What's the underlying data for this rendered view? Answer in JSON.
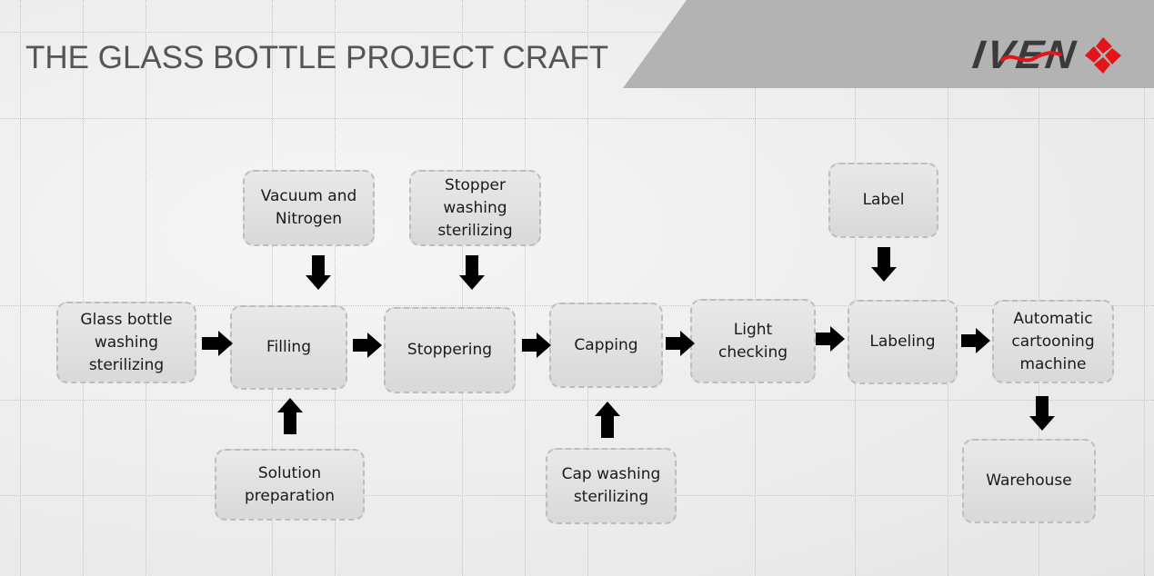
{
  "header": {
    "title": "THE GLASS BOTTLE PROJECT CRAFT",
    "logo_text": "IVEN",
    "logo_icon": "red-diamond-petals-icon",
    "accent_color": "#e3151b",
    "banner_color": "#b3b3b3"
  },
  "diagram": {
    "main_flow": [
      {
        "id": "glass-bottle-washing",
        "label": "Glass bottle\nwashing\nsterilizing"
      },
      {
        "id": "filling",
        "label": "Filling"
      },
      {
        "id": "stoppering",
        "label": "Stoppering"
      },
      {
        "id": "capping",
        "label": "Capping"
      },
      {
        "id": "light-checking",
        "label": "Light\nchecking"
      },
      {
        "id": "labeling",
        "label": "Labeling"
      },
      {
        "id": "automatic-cartooning",
        "label": "Automatic\ncartooning\nmachine"
      }
    ],
    "inputs": [
      {
        "id": "vacuum-nitrogen",
        "label": "Vacuum and\nNitrogen",
        "feeds": "filling",
        "position": "above"
      },
      {
        "id": "solution-preparation",
        "label": "Solution\npreparation",
        "feeds": "filling",
        "position": "below"
      },
      {
        "id": "stopper-washing",
        "label": "Stopper\nwashing\nsterilizing",
        "feeds": "stoppering",
        "position": "above"
      },
      {
        "id": "cap-washing",
        "label": "Cap washing\nsterilizing",
        "feeds": "capping",
        "position": "below"
      },
      {
        "id": "label",
        "label": "Label",
        "feeds": "labeling",
        "position": "above"
      }
    ],
    "output": {
      "id": "warehouse",
      "label": "Warehouse",
      "from": "automatic-cartooning"
    },
    "arrow_color": "#000000"
  }
}
